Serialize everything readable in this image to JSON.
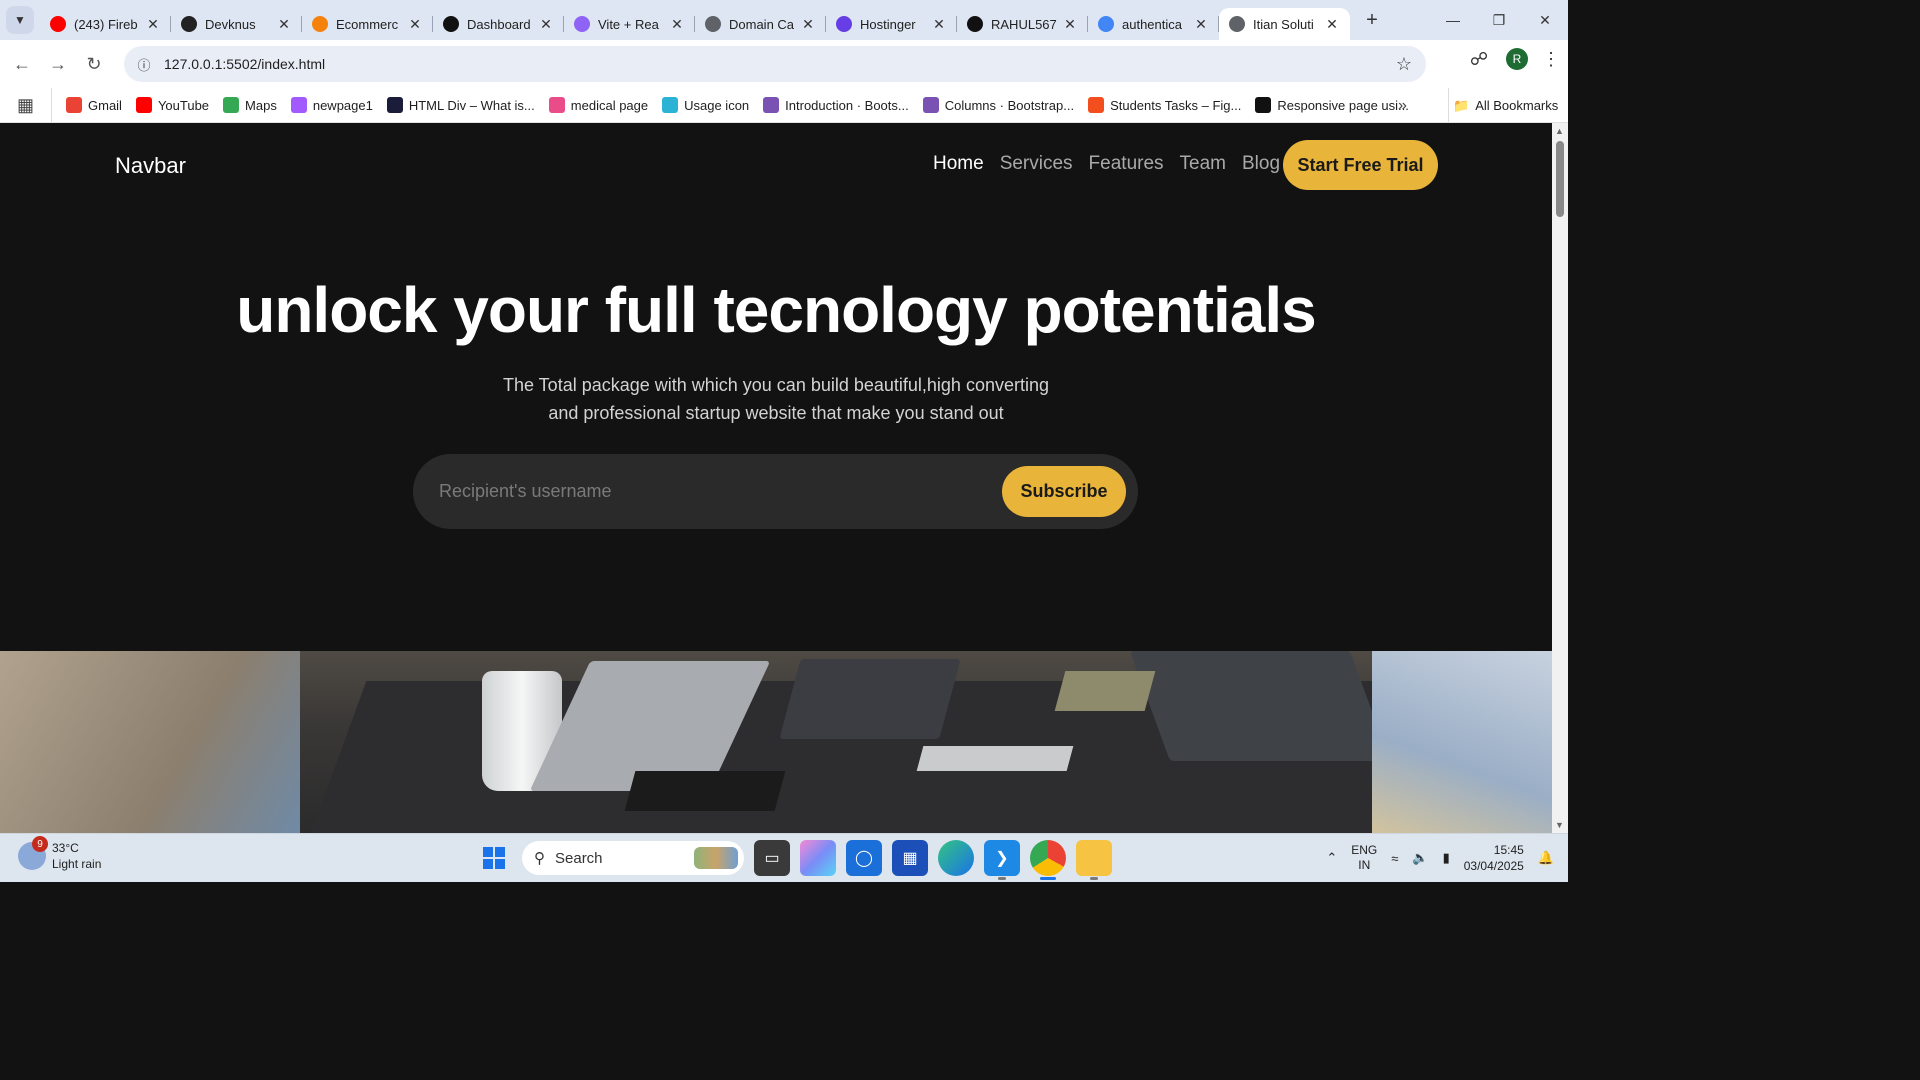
{
  "browser": {
    "tabs": [
      {
        "title": "(243) Fireb",
        "icon": "youtube-icon",
        "color": "#ff0000"
      },
      {
        "title": "Devknus",
        "icon": "devknus-icon",
        "color": "#222222"
      },
      {
        "title": "Ecommerc",
        "icon": "firebase-icon",
        "color": "#f5820d"
      },
      {
        "title": "Dashboard",
        "icon": "openai-icon",
        "color": "#111111"
      },
      {
        "title": "Vite + Rea",
        "icon": "vite-icon",
        "color": "#8f63f5"
      },
      {
        "title": "Domain Ca",
        "icon": "globe-icon",
        "color": "#5f6368"
      },
      {
        "title": "Hostinger",
        "icon": "hostinger-icon",
        "color": "#673de6"
      },
      {
        "title": "RAHUL567",
        "icon": "github-icon",
        "color": "#111111"
      },
      {
        "title": "authentica",
        "icon": "google-icon",
        "color": "#4285f4"
      },
      {
        "title": "Itian Soluti",
        "icon": "globe-icon",
        "color": "#5f6368",
        "active": true
      }
    ],
    "url": "127.0.0.1:5502/index.html",
    "profile_initial": "R",
    "bookmarks": [
      {
        "label": "Gmail",
        "icon": "gmail-icon",
        "color": "#ea4335"
      },
      {
        "label": "YouTube",
        "icon": "youtube-icon",
        "color": "#ff0000"
      },
      {
        "label": "Maps",
        "icon": "maps-icon",
        "color": "#34a853"
      },
      {
        "label": "newpage1",
        "icon": "figma-icon",
        "color": "#a259ff"
      },
      {
        "label": "HTML Div – What is...",
        "icon": "html-icon",
        "color": "#1b1b3a"
      },
      {
        "label": "medical page",
        "icon": "dribbble-icon",
        "color": "#ea4c89"
      },
      {
        "label": "Usage icon",
        "icon": "usage-icon",
        "color": "#2bb3d6"
      },
      {
        "label": "Introduction · Boots...",
        "icon": "bootstrap-icon",
        "color": "#7952b3"
      },
      {
        "label": "Columns · Bootstrap...",
        "icon": "bootstrap-icon",
        "color": "#7952b3"
      },
      {
        "label": "Students Tasks – Fig...",
        "icon": "figma-icon",
        "color": "#f24e1e"
      },
      {
        "label": "Responsive page usi...",
        "icon": "github-icon",
        "color": "#111111"
      }
    ],
    "all_bookmarks_label": "All Bookmarks"
  },
  "page": {
    "brand": "Navbar",
    "nav": [
      "Home",
      "Services",
      "Features",
      "Team",
      "Blog"
    ],
    "cta_label": "Start Free Trial",
    "hero_title": "unlock your full tecnology potentials",
    "hero_subtitle": "The Total package with which you can build beautiful,high converting and professional startup website that make you stand out",
    "subscribe_placeholder": "Recipient's username",
    "subscribe_label": "Subscribe",
    "accent_color": "#e8b43a"
  },
  "taskbar": {
    "weather_badge": "9",
    "temperature": "33°C",
    "condition": "Light rain",
    "search_label": "Search",
    "lang_line1": "ENG",
    "lang_line2": "IN",
    "time": "15:45",
    "date": "03/04/2025"
  }
}
